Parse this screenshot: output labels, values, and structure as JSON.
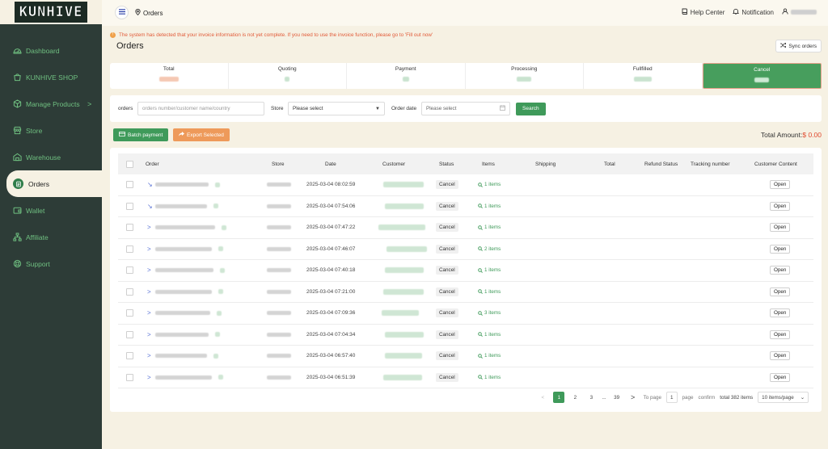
{
  "app": {
    "logo": "KUNHIVE"
  },
  "sidebar": {
    "items": [
      {
        "label": "Dashboard",
        "icon": "dashboard-icon"
      },
      {
        "label": "KUNHIVE SHOP",
        "icon": "shop-icon"
      },
      {
        "label": "Manage Products",
        "icon": "products-icon",
        "chevron": ">"
      },
      {
        "label": "Store",
        "icon": "store-icon"
      },
      {
        "label": "Warehouse",
        "icon": "warehouse-icon"
      },
      {
        "label": "Orders",
        "icon": "orders-icon",
        "active": true
      },
      {
        "label": "Wallet",
        "icon": "wallet-icon"
      },
      {
        "label": "Affiliate",
        "icon": "affiliate-icon"
      },
      {
        "label": "Support",
        "icon": "support-icon"
      }
    ]
  },
  "topbar": {
    "breadcrumb": "Orders",
    "help": "Help Center",
    "notification": "Notification"
  },
  "notice": {
    "text": "The system has detected that your invoice information is not yet complete. If you need to use the invoice function, please go to 'Fill out now'"
  },
  "page": {
    "title": "Orders",
    "sync_label": "Sync orders"
  },
  "status_tabs": [
    {
      "label": "Total"
    },
    {
      "label": "Quoting"
    },
    {
      "label": "Payment"
    },
    {
      "label": "Processing"
    },
    {
      "label": "Fullfilled"
    },
    {
      "label": "Cancel",
      "active": true
    }
  ],
  "filters": {
    "orders_label": "orders",
    "orders_placeholder": "orders number/customer name/country",
    "store_label": "Store",
    "store_value": "Please select",
    "date_label": "Order date",
    "date_placeholder": "Please select",
    "search_label": "Search"
  },
  "actions": {
    "batch_label": "Batch payment",
    "export_label": "Export Selected",
    "total_label": "Total Amount:",
    "total_value": "$ 0.00"
  },
  "table": {
    "columns": [
      "Order",
      "Store",
      "Date",
      "Customer",
      "Status",
      "Items",
      "Shipping",
      "Total",
      "Refund Status",
      "Tracking number",
      "Customer Content"
    ],
    "rows": [
      {
        "date": "2025-03-04 08:02:59",
        "status": "Cancel",
        "items": "1 items",
        "content": "Open"
      },
      {
        "date": "2025-03-04 07:54:06",
        "status": "Cancel",
        "items": "1 items",
        "content": "Open"
      },
      {
        "date": "2025-03-04 07:47:22",
        "status": "Cancel",
        "items": "1 items",
        "content": "Open"
      },
      {
        "date": "2025-03-04 07:46:07",
        "status": "Cancel",
        "items": "2 items",
        "content": "Open"
      },
      {
        "date": "2025-03-04 07:40:18",
        "status": "Cancel",
        "items": "1 items",
        "content": "Open"
      },
      {
        "date": "2025-03-04 07:21:00",
        "status": "Cancel",
        "items": "1 items",
        "content": "Open"
      },
      {
        "date": "2025-03-04 07:09:36",
        "status": "Cancel",
        "items": "3 items",
        "content": "Open"
      },
      {
        "date": "2025-03-04 07:04:34",
        "status": "Cancel",
        "items": "1 items",
        "content": "Open"
      },
      {
        "date": "2025-03-04 06:57:40",
        "status": "Cancel",
        "items": "1 items",
        "content": "Open"
      },
      {
        "date": "2025-03-04 06:51:39",
        "status": "Cancel",
        "items": "1 items",
        "content": "Open"
      }
    ]
  },
  "pagination": {
    "prev": "<",
    "pages": [
      "1",
      "2",
      "3",
      "...",
      "39"
    ],
    "next": ">",
    "to_page": "To page",
    "page_input": "1",
    "page_label": "page",
    "confirm": "confirm",
    "total": "total 382 items",
    "per_page": "10 items/page"
  },
  "colors": {
    "brand": "#3f9a5a",
    "sidebar": "#2d3c37",
    "accent_orange": "#ee9a5a",
    "warning": "#e15a38"
  }
}
